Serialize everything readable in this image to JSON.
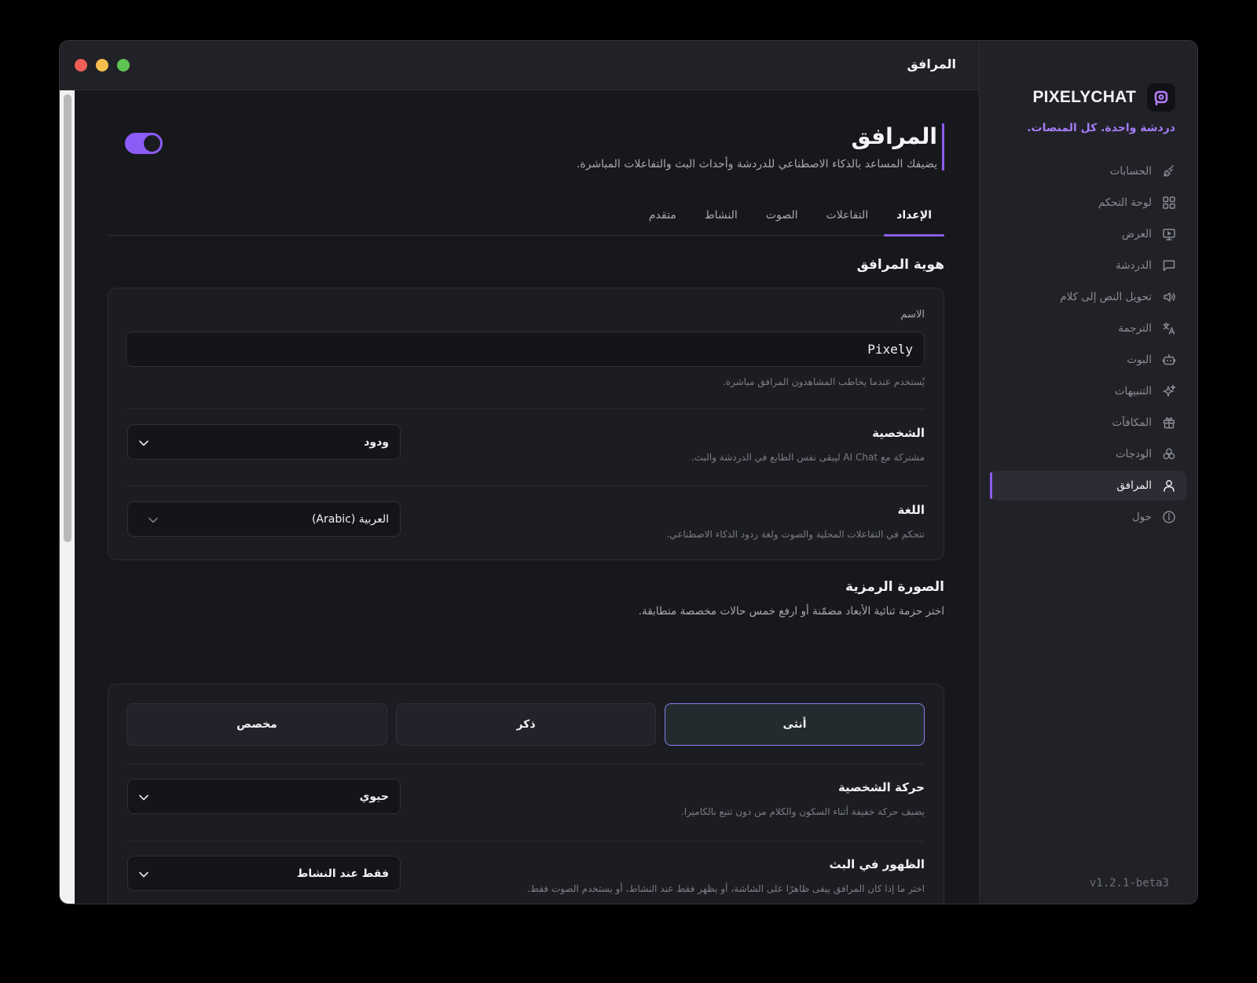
{
  "window": {
    "title": "المرافق"
  },
  "sidebar": {
    "brand": "PIXELYCHAT",
    "tagline": "دردشة واحدة. كل المنصات.",
    "items": [
      {
        "label": "الحسابات",
        "icon": "plug-icon"
      },
      {
        "label": "لوحة التحكم",
        "icon": "grid-icon"
      },
      {
        "label": "العرض",
        "icon": "monitor-icon"
      },
      {
        "label": "الدردشة",
        "icon": "message-icon"
      },
      {
        "label": "تحويل النص إلى كلام",
        "icon": "speaker-icon"
      },
      {
        "label": "الترجمة",
        "icon": "translate-icon"
      },
      {
        "label": "البوت",
        "icon": "bot-icon"
      },
      {
        "label": "التنبيهات",
        "icon": "sparkle-icon"
      },
      {
        "label": "المكافآت",
        "icon": "gift-icon"
      },
      {
        "label": "الودجات",
        "icon": "widgets-icon"
      },
      {
        "label": "المرافق",
        "icon": "user-icon",
        "active": true
      },
      {
        "label": "حول",
        "icon": "info-icon"
      }
    ],
    "version": "v1.2.1-beta3"
  },
  "page": {
    "title": "المرافق",
    "subtitle": "يضيفك المساعد بالذكاء الاصطناعي للدردشة وأحداث البث والتفاعلات المباشرة.",
    "enabled": true
  },
  "tabs": [
    {
      "label": "الإعداد",
      "active": true
    },
    {
      "label": "التفاعلات"
    },
    {
      "label": "الصوت"
    },
    {
      "label": "النشاط"
    },
    {
      "label": "متقدم"
    }
  ],
  "identity": {
    "section_title": "هوية المرافق",
    "name_label": "الاسم",
    "name_value": "Pixely",
    "name_hint": "يُستخدم عندما يخاطب المشاهدون المرافق مباشرة.",
    "personality_title": "الشخصية",
    "personality_desc": "مشتركة مع AI Chat ليبقى نفس الطابع في الدردشة والبث.",
    "personality_value": "ودود",
    "language_title": "اللغة",
    "language_desc": "تتحكم في التفاعلات المحلية والصوت ولغة ردود الذكاء الاصطناعي.",
    "language_value": "العربية (Arabic)"
  },
  "avatar": {
    "section_title": "الصورة الرمزية",
    "section_desc": "اختر حزمة ثنائية الأبعاد مضمّنة أو ارفع خمس حالات مخصصة متطابقة.",
    "options": [
      "أنثى",
      "ذكر",
      "مخصص"
    ],
    "selected": "أنثى",
    "motion_title": "حركة الشخصية",
    "motion_desc": "يضيف حركة خفيفة أثناء السكون والكلام من دون تتبع بالكاميرا.",
    "motion_value": "حيوي",
    "visibility_title": "الظهور في البث",
    "visibility_desc": "اختر ما إذا كان المرافق يبقى ظاهرًا على الشاشة، أو يظهر فقط عند النشاط، أو يستخدم الصوت فقط.",
    "visibility_value": "فقط عند النشاط"
  },
  "colors": {
    "accent": "#8b5cf6",
    "close": "#ee5f57",
    "minimize": "#f5be4f",
    "maximize": "#5ec454"
  }
}
